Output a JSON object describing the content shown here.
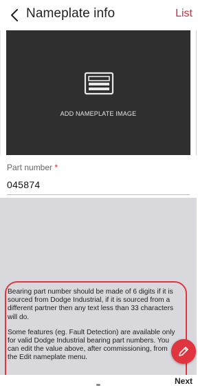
{
  "header": {
    "back_icon": "chevron-left-icon",
    "title": "Nameplate info",
    "list_label": "List",
    "accent_color": "#d32b3a"
  },
  "image_area": {
    "icon": "nameplate-icon",
    "label": "ADD NAMEPLATE IMAGE"
  },
  "form": {
    "part_number_label": "Part number",
    "required_marker": "*",
    "part_number_value": "045874"
  },
  "info": {
    "paragraph1": "Bearing part number should be made of 6 digits if it is sourced from Dodge Industrial, if it is sourced from a different partner then any text less than 33 characters will do.",
    "paragraph2": "Some features (eg. Fault Detection) are available only for valid Dodge Industrial bearing part numbers. You can edit the value above, after commissioning, from the Edit nameplate menu."
  },
  "fab": {
    "icon": "pencil-icon",
    "color": "#e0343f"
  },
  "footer": {
    "next_label": "Next"
  }
}
